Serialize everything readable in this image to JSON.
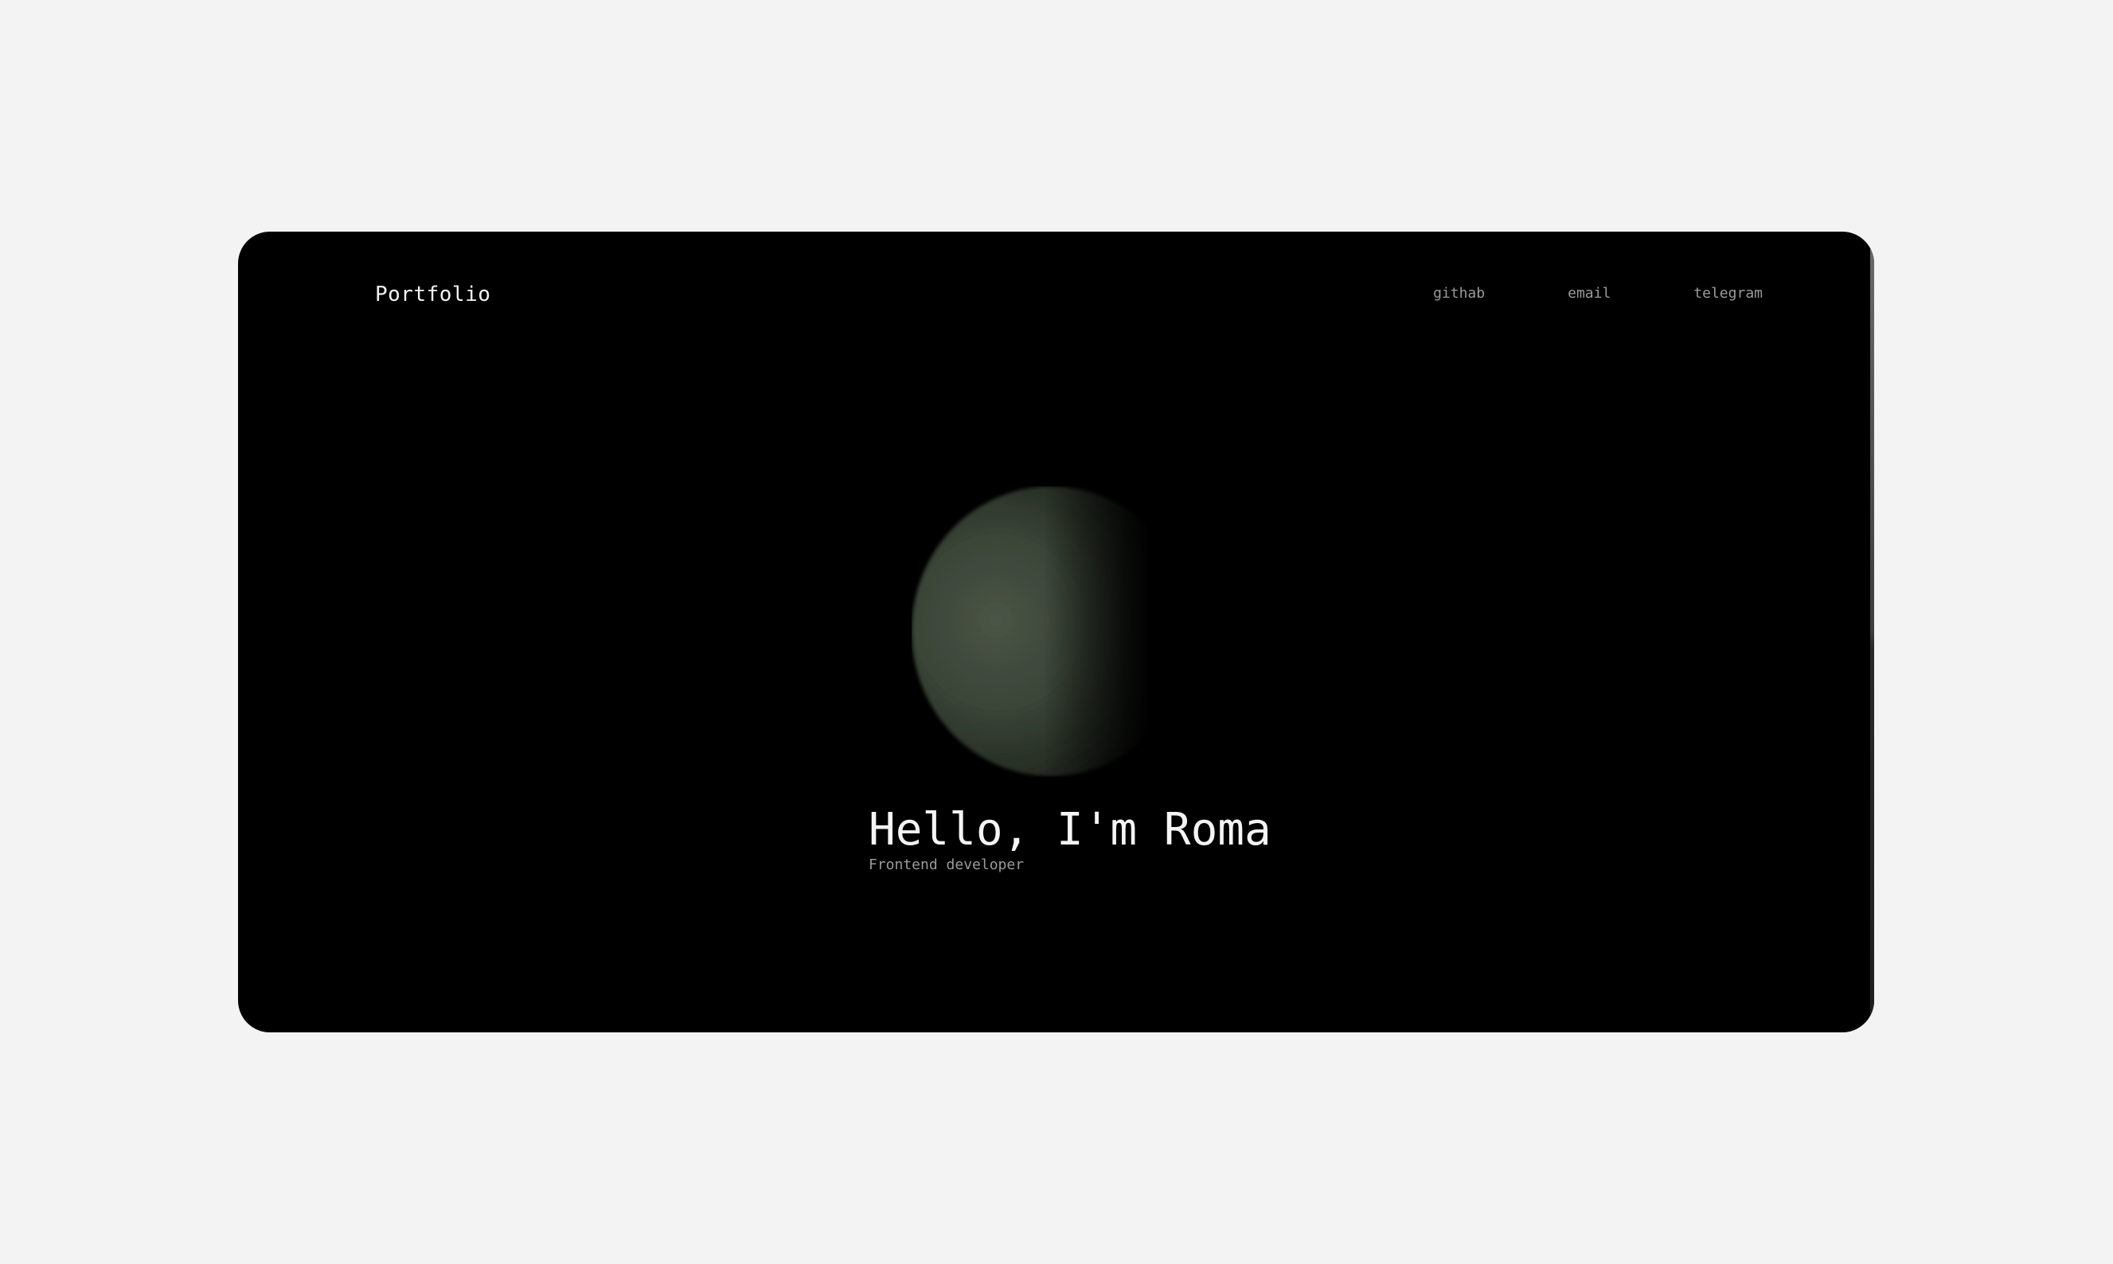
{
  "header": {
    "brand": "Portfolio",
    "nav": [
      "githab",
      "email",
      "telegram"
    ]
  },
  "hero": {
    "title": "Hello, I'm Roma",
    "subtitle": "Frontend developer"
  },
  "colors": {
    "page_background": "#f3f3f3",
    "window_background": "#000000",
    "sphere": "#3f4a3d"
  }
}
